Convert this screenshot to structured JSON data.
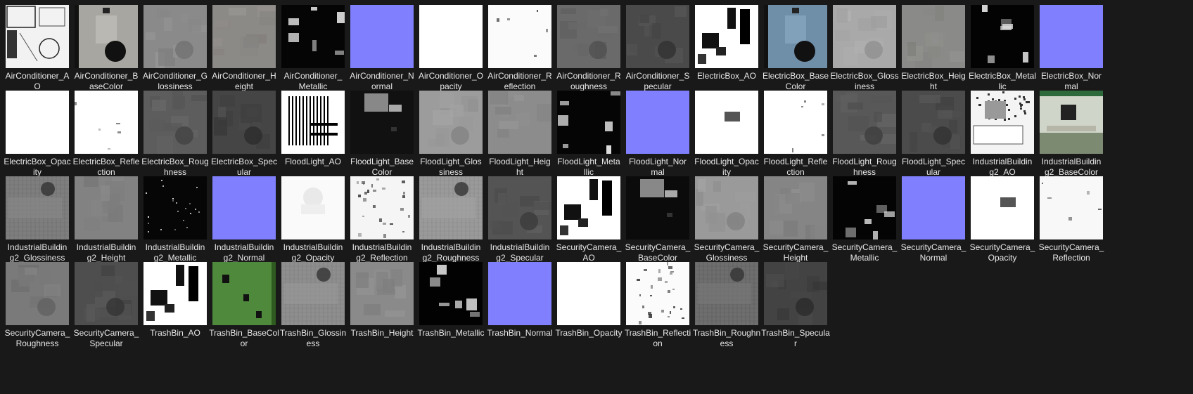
{
  "window": {
    "background": "#191919",
    "label_color": "#e8e8e8"
  },
  "files": [
    {
      "name": "AirConditioner_AO",
      "line1": "AirConditioner_A",
      "line2": "O",
      "kind": "ao",
      "base": "#f2f2f2"
    },
    {
      "name": "AirConditioner_BaseColor",
      "line1": "AirConditioner_B",
      "line2": "aseColor",
      "kind": "basecolor",
      "base": "#a8a6a0"
    },
    {
      "name": "AirConditioner_Glossiness",
      "line1": "AirConditioner_G",
      "line2": "lossiness",
      "kind": "gloss",
      "base": "#8a8a8a"
    },
    {
      "name": "AirConditioner_Height",
      "line1": "AirConditioner_H",
      "line2": "eight",
      "kind": "height",
      "base": "#8c8a87"
    },
    {
      "name": "AirConditioner_Metallic",
      "line1": "AirConditioner_",
      "line2": "Metallic",
      "kind": "metallic",
      "base": "#050505"
    },
    {
      "name": "AirConditioner_Normal",
      "line1": "AirConditioner_N",
      "line2": "ormal",
      "kind": "normal",
      "base": "#8080ff"
    },
    {
      "name": "AirConditioner_Opacity",
      "line1": "AirConditioner_O",
      "line2": "pacity",
      "kind": "opacity",
      "base": "#ffffff"
    },
    {
      "name": "AirConditioner_Reflection",
      "line1": "AirConditioner_R",
      "line2": "eflection",
      "kind": "reflection",
      "base": "#fbfbfb"
    },
    {
      "name": "AirConditioner_Roughness",
      "line1": "AirConditioner_R",
      "line2": "oughness",
      "kind": "rough",
      "base": "#6a6a6a"
    },
    {
      "name": "AirConditioner_Specular",
      "line1": "AirConditioner_S",
      "line2": "pecular",
      "kind": "spec",
      "base": "#4a4a4a"
    },
    {
      "name": "ElectricBox_AO",
      "line1": "ElectricBox_AO",
      "line2": "",
      "kind": "ao-blocks",
      "base": "#ffffff"
    },
    {
      "name": "ElectricBox_BaseColor",
      "line1": "ElectricBox_Base",
      "line2": "Color",
      "kind": "basecolor",
      "base": "#6f8ea8"
    },
    {
      "name": "ElectricBox_Glossiness",
      "line1": "ElectricBox_Gloss",
      "line2": "iness",
      "kind": "gloss",
      "base": "#a9a9a9"
    },
    {
      "name": "ElectricBox_Height",
      "line1": "ElectricBox_Heig",
      "line2": "ht",
      "kind": "height",
      "base": "#8a8a88"
    },
    {
      "name": "ElectricBox_Metallic",
      "line1": "ElectricBox_Metal",
      "line2": "lic",
      "kind": "metallic",
      "base": "#030303"
    },
    {
      "name": "ElectricBox_Normal",
      "line1": "ElectricBox_Nor",
      "line2": "mal",
      "kind": "normal",
      "base": "#8080ff"
    },
    {
      "name": "ElectricBox_Opacity",
      "line1": "ElectricBox_Opac",
      "line2": "ity",
      "kind": "opacity",
      "base": "#ffffff"
    },
    {
      "name": "ElectricBox_Reflection",
      "line1": "ElectricBox_Refle",
      "line2": "ction",
      "kind": "reflection",
      "base": "#ffffff"
    },
    {
      "name": "ElectricBox_Roughness",
      "line1": "ElectricBox_Roug",
      "line2": "hness",
      "kind": "rough",
      "base": "#5d5d5d"
    },
    {
      "name": "ElectricBox_Specular",
      "line1": "ElectricBox_Spec",
      "line2": "ular",
      "kind": "spec",
      "base": "#454545"
    },
    {
      "name": "FloodLight_AO",
      "line1": "FloodLight_AO",
      "line2": "",
      "kind": "ao-lines",
      "base": "#ffffff"
    },
    {
      "name": "FloodLight_BaseColor",
      "line1": "FloodLight_Base",
      "line2": "Color",
      "kind": "basecolor-dark",
      "base": "#111111"
    },
    {
      "name": "FloodLight_Glossiness",
      "line1": "FloodLight_Glos",
      "line2": "siness",
      "kind": "gloss",
      "base": "#9c9c9c"
    },
    {
      "name": "FloodLight_Height",
      "line1": "FloodLight_Heig",
      "line2": "ht",
      "kind": "height",
      "base": "#8c8c8c"
    },
    {
      "name": "FloodLight_Metallic",
      "line1": "FloodLight_Meta",
      "line2": "llic",
      "kind": "metallic",
      "base": "#050505"
    },
    {
      "name": "FloodLight_Normal",
      "line1": "FloodLight_Nor",
      "line2": "mal",
      "kind": "normal",
      "base": "#8080ff"
    },
    {
      "name": "FloodLight_Opacity",
      "line1": "FloodLight_Opac",
      "line2": "ity",
      "kind": "opacity-mark",
      "base": "#ffffff"
    },
    {
      "name": "FloodLight_Reflection",
      "line1": "FloodLight_Refle",
      "line2": "ction",
      "kind": "reflection",
      "base": "#ffffff"
    },
    {
      "name": "FloodLight_Roughness",
      "line1": "FloodLight_Roug",
      "line2": "hness",
      "kind": "rough",
      "base": "#585858"
    },
    {
      "name": "FloodLight_Specular",
      "line1": "FloodLight_Spec",
      "line2": "ular",
      "kind": "spec",
      "base": "#4b4b4b"
    },
    {
      "name": "IndustrialBuilding2_AO",
      "line1": "IndustrialBuildin",
      "line2": "g2_AO",
      "kind": "ao-industrial",
      "base": "#f4f4f4"
    },
    {
      "name": "IndustrialBuilding2_BaseColor",
      "line1": "IndustrialBuildin",
      "line2": "g2_BaseColor",
      "kind": "basecolor-green",
      "base": "#cfd5c9"
    },
    {
      "name": "IndustrialBuilding2_Glossiness",
      "line1": "IndustrialBuildin",
      "line2": "g2_Glossiness",
      "kind": "gloss-grid",
      "base": "#7e7e7e"
    },
    {
      "name": "IndustrialBuilding2_Height",
      "line1": "IndustrialBuildin",
      "line2": "g2_Height",
      "kind": "height",
      "base": "#828282"
    },
    {
      "name": "IndustrialBuilding2_Metallic",
      "line1": "IndustrialBuildin",
      "line2": "g2_Metallic",
      "kind": "metallic-dots",
      "base": "#060606"
    },
    {
      "name": "IndustrialBuilding2_Normal",
      "line1": "IndustrialBuildin",
      "line2": "g2_Normal",
      "kind": "normal",
      "base": "#8080ff"
    },
    {
      "name": "IndustrialBuilding2_Opacity",
      "line1": "IndustrialBuildin",
      "line2": "g2_Opacity",
      "kind": "opacity-faint",
      "base": "#fafafa"
    },
    {
      "name": "IndustrialBuilding2_Reflection",
      "line1": "IndustrialBuildin",
      "line2": "g2_Reflection",
      "kind": "reflection-dots",
      "base": "#f5f5f5"
    },
    {
      "name": "IndustrialBuilding2_Roughness",
      "line1": "IndustrialBuildin",
      "line2": "g2_Roughness",
      "kind": "rough-grid",
      "base": "#9a9a9a"
    },
    {
      "name": "IndustrialBuilding2_Specular",
      "line1": "IndustrialBuildin",
      "line2": "g2_Specular",
      "kind": "spec",
      "base": "#545454"
    },
    {
      "name": "SecurityCamera_AO",
      "line1": "SecurityCamera_",
      "line2": "AO",
      "kind": "ao-blocks",
      "base": "#ffffff"
    },
    {
      "name": "SecurityCamera_BaseColor",
      "line1": "SecurityCamera_",
      "line2": "BaseColor",
      "kind": "basecolor-dark",
      "base": "#0b0b0b"
    },
    {
      "name": "SecurityCamera_Glossiness",
      "line1": "SecurityCamera_",
      "line2": "Glossiness",
      "kind": "gloss",
      "base": "#9a9a9a"
    },
    {
      "name": "SecurityCamera_Height",
      "line1": "SecurityCamera_",
      "line2": "Height",
      "kind": "height",
      "base": "#858585"
    },
    {
      "name": "SecurityCamera_Metallic",
      "line1": "SecurityCamera_",
      "line2": "Metallic",
      "kind": "metallic",
      "base": "#040404"
    },
    {
      "name": "SecurityCamera_Normal",
      "line1": "SecurityCamera_",
      "line2": "Normal",
      "kind": "normal",
      "base": "#8080ff"
    },
    {
      "name": "SecurityCamera_Opacity",
      "line1": "SecurityCamera_",
      "line2": "Opacity",
      "kind": "opacity-mark",
      "base": "#ffffff"
    },
    {
      "name": "SecurityCamera_Reflection",
      "line1": "SecurityCamera_",
      "line2": "Reflection",
      "kind": "reflection",
      "base": "#f8f8f8"
    },
    {
      "name": "SecurityCamera_Roughness",
      "line1": "SecurityCamera_",
      "line2": "Roughness",
      "kind": "rough",
      "base": "#7a7a7a"
    },
    {
      "name": "SecurityCamera_Specular",
      "line1": "SecurityCamera_",
      "line2": "Specular",
      "kind": "spec",
      "base": "#4e4e4e"
    },
    {
      "name": "TrashBin_AO",
      "line1": "TrashBin_AO",
      "line2": "",
      "kind": "ao-blocks",
      "base": "#ffffff"
    },
    {
      "name": "TrashBin_BaseColor",
      "line1": "TrashBin_BaseCol",
      "line2": "or",
      "kind": "basecolor-trash",
      "base": "#4f8a3c"
    },
    {
      "name": "TrashBin_Glossiness",
      "line1": "TrashBin_Glossin",
      "line2": "ess",
      "kind": "gloss-grid",
      "base": "#8e8e8e"
    },
    {
      "name": "TrashBin_Height",
      "line1": "TrashBin_Height",
      "line2": "",
      "kind": "height",
      "base": "#8a8a8a"
    },
    {
      "name": "TrashBin_Metallic",
      "line1": "TrashBin_Metallic",
      "line2": "",
      "kind": "metallic",
      "base": "#020202"
    },
    {
      "name": "TrashBin_Normal",
      "line1": "TrashBin_Normal",
      "line2": "",
      "kind": "normal",
      "base": "#8080ff"
    },
    {
      "name": "TrashBin_Opacity",
      "line1": "TrashBin_Opacity",
      "line2": "",
      "kind": "opacity",
      "base": "#ffffff"
    },
    {
      "name": "TrashBin_Reflection",
      "line1": "TrashBin_Reflecti",
      "line2": "on",
      "kind": "reflection-dots",
      "base": "#fbfbfb"
    },
    {
      "name": "TrashBin_Roughness",
      "line1": "TrashBin_Roughn",
      "line2": "ess",
      "kind": "rough-grid",
      "base": "#6e6e6e"
    },
    {
      "name": "TrashBin_Specular",
      "line1": "TrashBin_Specula",
      "line2": "r",
      "kind": "spec",
      "base": "#434343"
    }
  ]
}
